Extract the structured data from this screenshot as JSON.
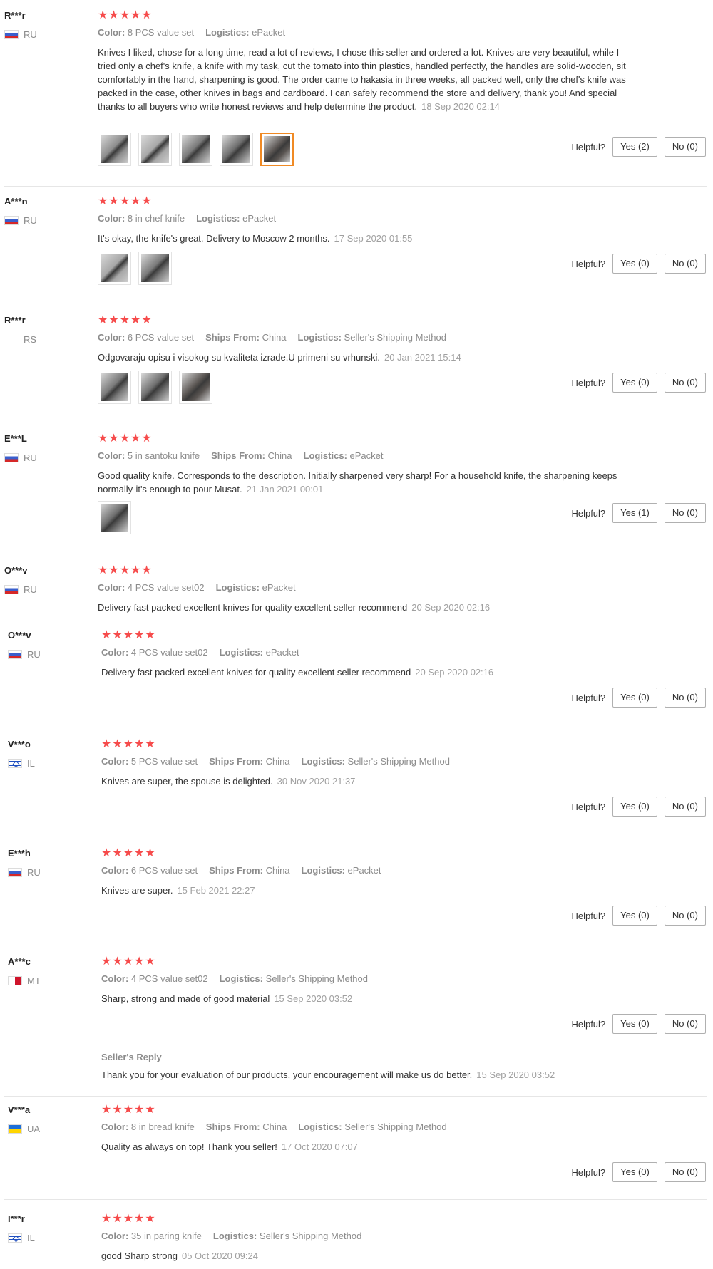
{
  "helpful_label": "Helpful?",
  "stars": "★★★★★",
  "reviews": [
    {
      "buyer": "R***r",
      "country": "RU",
      "flag": "ru",
      "meta": [
        [
          "Color:",
          "8 PCS value set"
        ],
        [
          "Logistics:",
          "ePacket"
        ]
      ],
      "text": "Knives I liked, chose for a long time, read a lot of reviews, I chose this seller and ordered a lot. Knives are very beautiful, while I tried only a chef's knife, a knife with my task, cut the tomato into thin plastics, handled perfectly, the handles are solid-wooden, sit comfortably in the hand, sharpening is good. The order came to hakasia in three weeks, all packed well, only the chef's knife was packed in the case, other knives in bags and cardboard. I can safely recommend the store and delivery, thank you! And special thanks to all buyers who write honest reviews and help determine the product.",
      "date": "18 Sep 2020 02:14",
      "photos": 5,
      "yes": "Yes (2)",
      "no": "No (0)"
    },
    {
      "buyer": "A***n",
      "country": "RU",
      "flag": "ru",
      "meta": [
        [
          "Color:",
          "8 in chef knife"
        ],
        [
          "Logistics:",
          "ePacket"
        ]
      ],
      "text": "It's okay, the knife's great. Delivery to Moscow 2 months.",
      "date": "17 Sep 2020 01:55",
      "photos": 2,
      "yes": "Yes (0)",
      "no": "No (0)"
    },
    {
      "buyer": "R***r",
      "country": "RS",
      "flag": "none",
      "meta": [
        [
          "Color:",
          "6 PCS value set"
        ],
        [
          "Ships From:",
          "China"
        ],
        [
          "Logistics:",
          "Seller's Shipping Method"
        ]
      ],
      "text": "Odgovaraju opisu i visokog su kvaliteta izrade.U primeni su vrhunski.",
      "date": "20 Jan 2021 15:14",
      "photos": 3,
      "yes": "Yes (0)",
      "no": "No (0)"
    },
    {
      "buyer": "E***L",
      "country": "RU",
      "flag": "ru",
      "meta": [
        [
          "Color:",
          "5 in santoku knife"
        ],
        [
          "Ships From:",
          "China"
        ],
        [
          "Logistics:",
          "ePacket"
        ]
      ],
      "text": "Good quality knife. Corresponds to the description. Initially sharpened very sharp! For a household knife, the sharpening keeps normally-it's enough to pour Musat.",
      "date": "21 Jan 2021 00:01",
      "photos": 1,
      "yes": "Yes (1)",
      "no": "No (0)"
    },
    {
      "buyer": "O***v",
      "country": "RU",
      "flag": "ru",
      "meta": [
        [
          "Color:",
          "4 PCS value set02"
        ],
        [
          "Logistics:",
          "ePacket"
        ]
      ],
      "text": "Delivery fast packed excellent knives for quality excellent seller recommend",
      "date": "20 Sep 2020 02:16"
    },
    {
      "buyer": "O***v",
      "country": "RU",
      "flag": "ru",
      "meta": [
        [
          "Color:",
          "4 PCS value set02"
        ],
        [
          "Logistics:",
          "ePacket"
        ]
      ],
      "text": "Delivery fast packed excellent knives for quality excellent seller recommend",
      "date": "20 Sep 2020 02:16",
      "yes": "Yes (0)",
      "no": "No (0)"
    },
    {
      "buyer": "V***o",
      "country": "IL",
      "flag": "il",
      "meta": [
        [
          "Color:",
          "5 PCS value set"
        ],
        [
          "Ships From:",
          "China"
        ],
        [
          "Logistics:",
          "Seller's Shipping Method"
        ]
      ],
      "text": "Knives are super, the spouse is delighted.",
      "date": "30 Nov 2020 21:37",
      "yes": "Yes (0)",
      "no": "No (0)"
    },
    {
      "buyer": "E***h",
      "country": "RU",
      "flag": "ru",
      "meta": [
        [
          "Color:",
          "6 PCS value set"
        ],
        [
          "Ships From:",
          "China"
        ],
        [
          "Logistics:",
          "ePacket"
        ]
      ],
      "text": "Knives are super.",
      "date": "15 Feb 2021 22:27",
      "yes": "Yes (0)",
      "no": "No (0)"
    },
    {
      "buyer": "A***c",
      "country": "MT",
      "flag": "mt",
      "meta": [
        [
          "Color:",
          "4 PCS value set02"
        ],
        [
          "Logistics:",
          "Seller's Shipping Method"
        ]
      ],
      "text": "Sharp, strong and made of good material",
      "date": "15 Sep 2020 03:52",
      "yes": "Yes (0)",
      "no": "No (0)",
      "reply_title": "Seller's Reply",
      "reply_text": "Thank you for your evaluation of our products, your encouragement will make us do better.",
      "reply_date": "15 Sep 2020 03:52"
    },
    {
      "buyer": "V***a",
      "country": "UA",
      "flag": "ua",
      "meta": [
        [
          "Color:",
          "8 in bread knife"
        ],
        [
          "Ships From:",
          "China"
        ],
        [
          "Logistics:",
          "Seller's Shipping Method"
        ]
      ],
      "text": "Quality as always on top! Thank you seller!",
      "date": "17 Oct 2020 07:07",
      "yes": "Yes (0)",
      "no": "No (0)"
    },
    {
      "buyer": "I***r",
      "country": "IL",
      "flag": "il",
      "meta": [
        [
          "Color:",
          "35 in paring knife"
        ],
        [
          "Logistics:",
          "Seller's Shipping Method"
        ]
      ],
      "text": "good Sharp strong",
      "date": "05 Oct 2020 09:24"
    }
  ]
}
